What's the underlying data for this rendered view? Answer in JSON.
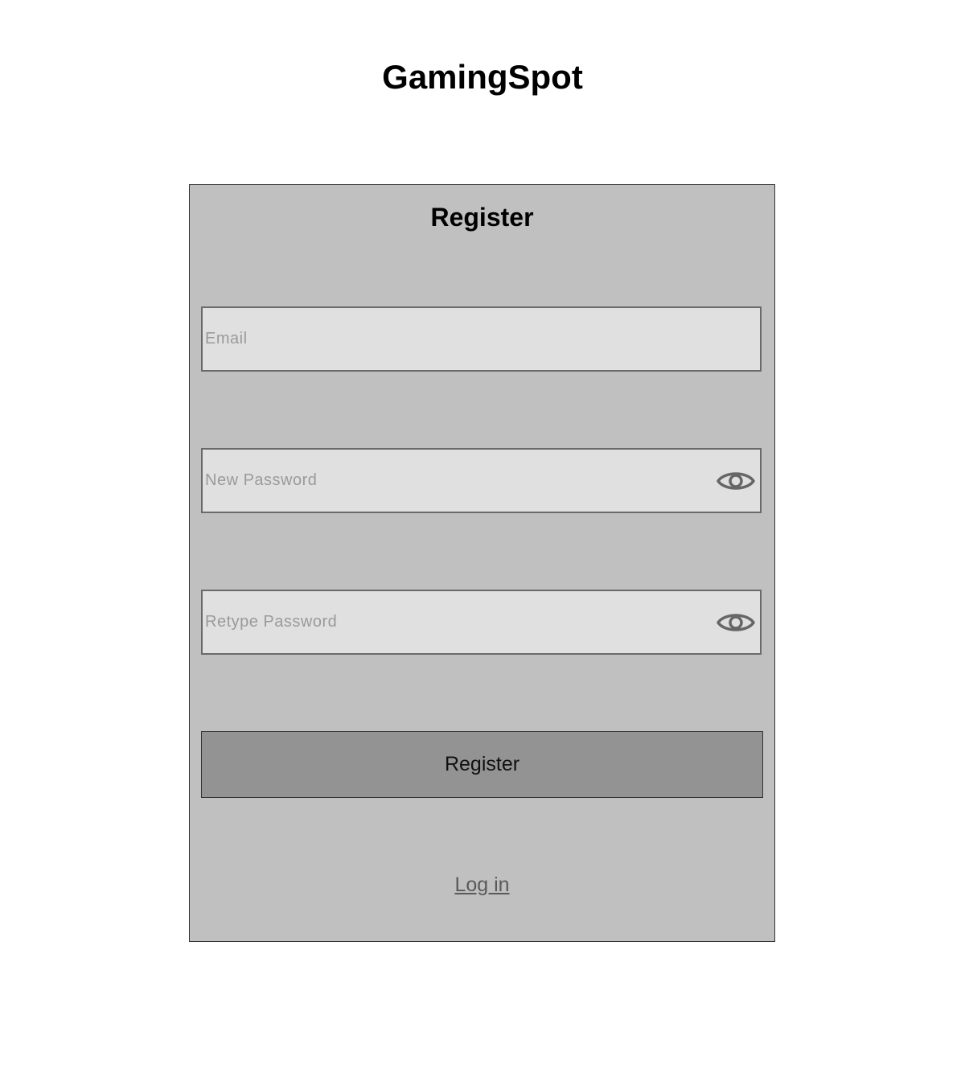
{
  "app": {
    "title": "GamingSpot"
  },
  "register_card": {
    "title": "Register",
    "email": {
      "placeholder": "Email",
      "value": ""
    },
    "new_password": {
      "placeholder": "New Password",
      "value": "",
      "toggle_icon": "eye-icon"
    },
    "retype_password": {
      "placeholder": "Retype Password",
      "value": "",
      "toggle_icon": "eye-icon"
    },
    "register_button_label": "Register",
    "login_link_label": "Log in"
  },
  "colors": {
    "card_background": "#c0c0c0",
    "field_background": "#e0e0e0",
    "button_background": "#939393",
    "link_color": "#5a5a5a"
  }
}
